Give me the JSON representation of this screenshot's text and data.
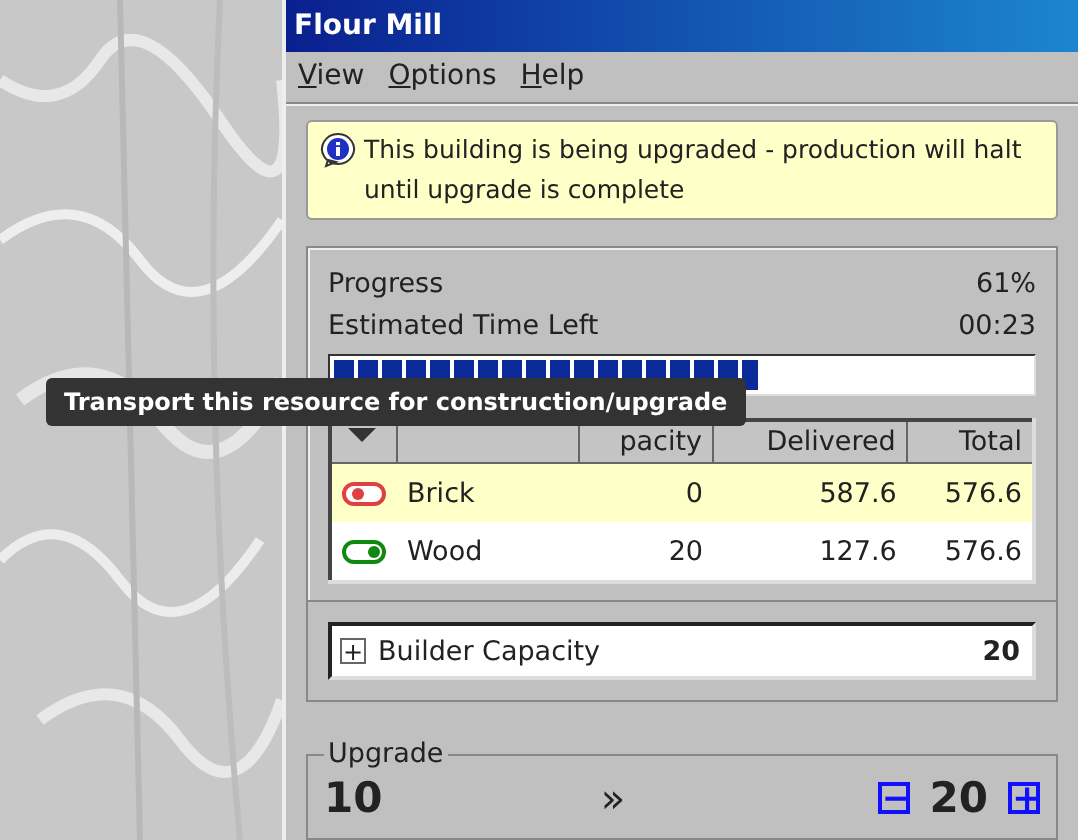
{
  "window": {
    "title": "Flour Mill"
  },
  "menu": [
    {
      "mnemonic": "V",
      "rest": "iew"
    },
    {
      "mnemonic": "O",
      "rest": "ptions"
    },
    {
      "mnemonic": "H",
      "rest": "elp"
    }
  ],
  "notice": {
    "text": "This building is being upgraded - production will halt until upgrade is complete"
  },
  "progress": {
    "label": "Progress",
    "value": "61%",
    "time_label": "Estimated Time Left",
    "time_value": "00:23",
    "level": 0.61
  },
  "table": {
    "columns": [
      "",
      "",
      "pacity",
      "Delivered",
      "Total"
    ],
    "rows": [
      {
        "transport": false,
        "resource": "Brick",
        "capacity": "0",
        "delivered": "587.6",
        "total": "576.6",
        "selected": true
      },
      {
        "transport": true,
        "resource": "Wood",
        "capacity": "20",
        "delivered": "127.6",
        "total": "576.6",
        "selected": false
      }
    ]
  },
  "tooltip": {
    "text": "Transport this resource for construction/upgrade"
  },
  "builder": {
    "expand": "+",
    "label": "Builder Capacity",
    "value": "20"
  },
  "upgrade": {
    "title": "Upgrade",
    "current": "10",
    "arrow": "»",
    "minus": "−",
    "target": "20",
    "plus": "+"
  }
}
